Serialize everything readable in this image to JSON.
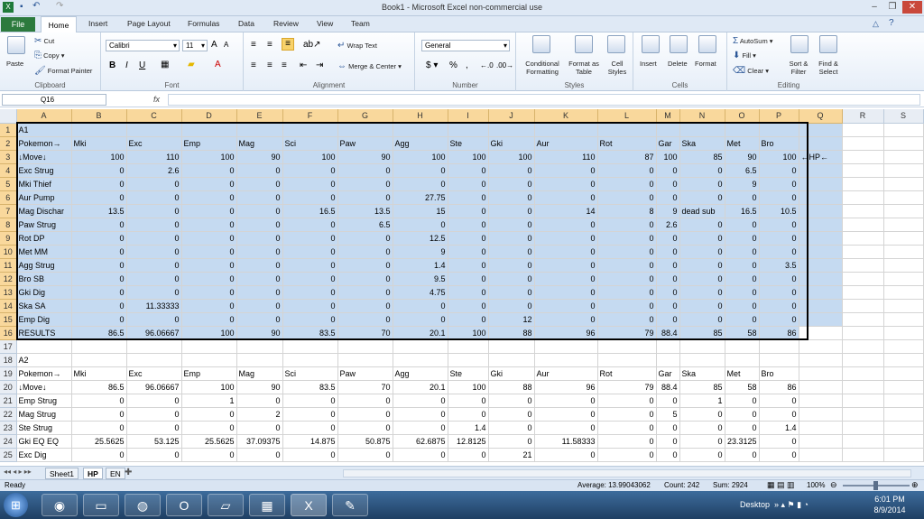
{
  "window": {
    "title": "Book1 - Microsoft Excel non-commercial use"
  },
  "tabs": [
    "File",
    "Home",
    "Insert",
    "Page Layout",
    "Formulas",
    "Data",
    "Review",
    "View",
    "Team"
  ],
  "ribbon": {
    "clipboard": {
      "paste": "Paste",
      "cut": "Cut",
      "copy": "Copy",
      "format_painter": "Format Painter",
      "label": "Clipboard"
    },
    "font": {
      "name": "Calibri",
      "size": "11",
      "label": "Font"
    },
    "alignment": {
      "wrap": "Wrap Text",
      "merge": "Merge & Center",
      "label": "Alignment"
    },
    "number": {
      "format": "General",
      "label": "Number"
    },
    "styles": {
      "cond": "Conditional Formatting",
      "fmt_table": "Format as Table",
      "cell_styles": "Cell Styles",
      "label": "Styles"
    },
    "cells": {
      "insert": "Insert",
      "delete": "Delete",
      "format": "Format",
      "label": "Cells"
    },
    "editing": {
      "autosum": "AutoSum",
      "fill": "Fill",
      "clear": "Clear",
      "sort": "Sort & Filter",
      "find": "Find & Select",
      "label": "Editing"
    }
  },
  "formula_bar": {
    "name_box": "Q16",
    "fx": "fx",
    "value": ""
  },
  "columns": [
    "A",
    "B",
    "C",
    "D",
    "E",
    "F",
    "G",
    "H",
    "I",
    "J",
    "K",
    "L",
    "M",
    "N",
    "O",
    "P",
    "Q",
    "R",
    "S"
  ],
  "rows": [
    {
      "n": "1",
      "c": [
        "A1",
        "",
        "",
        "",
        "",
        "",
        "",
        "",
        "",
        "",
        "",
        "",
        "",
        "",
        "",
        "",
        ""
      ]
    },
    {
      "n": "2",
      "c": [
        "Pokemon→",
        "Mki",
        "Exc",
        "Emp",
        "Mag",
        "Sci",
        "Paw",
        "Agg",
        "Ste",
        "Gki",
        "Aur",
        "Rot",
        "Gar",
        "Ska",
        "Met",
        "Bro",
        ""
      ]
    },
    {
      "n": "3",
      "c": [
        "↓Move↓",
        "100",
        "110",
        "100",
        "90",
        "100",
        "90",
        "100",
        "100",
        "100",
        "110",
        "87",
        "100",
        "85",
        "90",
        "100",
        "←HP←"
      ]
    },
    {
      "n": "4",
      "c": [
        "Exc Strug",
        "0",
        "2.6",
        "0",
        "0",
        "0",
        "0",
        "0",
        "0",
        "0",
        "0",
        "0",
        "0",
        "0",
        "6.5",
        "0",
        ""
      ]
    },
    {
      "n": "5",
      "c": [
        "Mki Thief",
        "0",
        "0",
        "0",
        "0",
        "0",
        "0",
        "0",
        "0",
        "0",
        "0",
        "0",
        "0",
        "0",
        "9",
        "0",
        ""
      ]
    },
    {
      "n": "6",
      "c": [
        "Aur Pump",
        "0",
        "0",
        "0",
        "0",
        "0",
        "0",
        "27.75",
        "0",
        "0",
        "0",
        "0",
        "0",
        "0",
        "0",
        "0",
        ""
      ]
    },
    {
      "n": "7",
      "c": [
        "Mag Dischar",
        "13.5",
        "0",
        "0",
        "0",
        "16.5",
        "13.5",
        "15",
        "0",
        "0",
        "14",
        "8",
        "9",
        "dead sub",
        "16.5",
        "10.5",
        ""
      ]
    },
    {
      "n": "8",
      "c": [
        "Paw Strug",
        "0",
        "0",
        "0",
        "0",
        "0",
        "6.5",
        "0",
        "0",
        "0",
        "0",
        "0",
        "2.6",
        "0",
        "0",
        "0",
        ""
      ]
    },
    {
      "n": "9",
      "c": [
        "Rot DP",
        "0",
        "0",
        "0",
        "0",
        "0",
        "0",
        "12.5",
        "0",
        "0",
        "0",
        "0",
        "0",
        "0",
        "0",
        "0",
        ""
      ]
    },
    {
      "n": "10",
      "c": [
        "Met MM",
        "0",
        "0",
        "0",
        "0",
        "0",
        "0",
        "9",
        "0",
        "0",
        "0",
        "0",
        "0",
        "0",
        "0",
        "0",
        ""
      ]
    },
    {
      "n": "11",
      "c": [
        "Agg Strug",
        "0",
        "0",
        "0",
        "0",
        "0",
        "0",
        "1.4",
        "0",
        "0",
        "0",
        "0",
        "0",
        "0",
        "0",
        "3.5",
        ""
      ]
    },
    {
      "n": "12",
      "c": [
        "Bro SB",
        "0",
        "0",
        "0",
        "0",
        "0",
        "0",
        "9.5",
        "0",
        "0",
        "0",
        "0",
        "0",
        "0",
        "0",
        "0",
        ""
      ]
    },
    {
      "n": "13",
      "c": [
        "Gki Dig",
        "0",
        "0",
        "0",
        "0",
        "0",
        "0",
        "4.75",
        "0",
        "0",
        "0",
        "0",
        "0",
        "0",
        "0",
        "0",
        ""
      ]
    },
    {
      "n": "14",
      "c": [
        "Ska SA",
        "0",
        "11.33333",
        "0",
        "0",
        "0",
        "0",
        "0",
        "0",
        "0",
        "0",
        "0",
        "0",
        "0",
        "0",
        "0",
        ""
      ]
    },
    {
      "n": "15",
      "c": [
        "Emp Dig",
        "0",
        "0",
        "0",
        "0",
        "0",
        "0",
        "0",
        "0",
        "12",
        "0",
        "0",
        "0",
        "0",
        "0",
        "0",
        ""
      ]
    },
    {
      "n": "16",
      "c": [
        "RESULTS",
        "86.5",
        "96.06667",
        "100",
        "90",
        "83.5",
        "70",
        "20.1",
        "100",
        "88",
        "96",
        "79",
        "88.4",
        "85",
        "58",
        "86",
        ""
      ]
    },
    {
      "n": "17",
      "c": [
        "",
        "",
        "",
        "",
        "",
        "",
        "",
        "",
        "",
        "",
        "",
        "",
        "",
        "",
        "",
        "",
        ""
      ]
    },
    {
      "n": "18",
      "c": [
        "A2",
        "",
        "",
        "",
        "",
        "",
        "",
        "",
        "",
        "",
        "",
        "",
        "",
        "",
        "",
        "",
        ""
      ]
    },
    {
      "n": "19",
      "c": [
        "Pokemon→",
        "Mki",
        "Exc",
        "Emp",
        "Mag",
        "Sci",
        "Paw",
        "Agg",
        "Ste",
        "Gki",
        "Aur",
        "Rot",
        "Gar",
        "Ska",
        "Met",
        "Bro",
        ""
      ]
    },
    {
      "n": "20",
      "c": [
        "↓Move↓",
        "86.5",
        "96.06667",
        "100",
        "90",
        "83.5",
        "70",
        "20.1",
        "100",
        "88",
        "96",
        "79",
        "88.4",
        "85",
        "58",
        "86",
        ""
      ]
    },
    {
      "n": "21",
      "c": [
        "Emp Strug",
        "0",
        "0",
        "1",
        "0",
        "0",
        "0",
        "0",
        "0",
        "0",
        "0",
        "0",
        "0",
        "1",
        "0",
        "0",
        ""
      ]
    },
    {
      "n": "22",
      "c": [
        "Mag Strug",
        "0",
        "0",
        "0",
        "2",
        "0",
        "0",
        "0",
        "0",
        "0",
        "0",
        "0",
        "5",
        "0",
        "0",
        "0",
        ""
      ]
    },
    {
      "n": "23",
      "c": [
        "Ste Strug",
        "0",
        "0",
        "0",
        "0",
        "0",
        "0",
        "0",
        "1.4",
        "0",
        "0",
        "0",
        "0",
        "0",
        "0",
        "1.4",
        ""
      ]
    },
    {
      "n": "24",
      "c": [
        "Gki EQ EQ",
        "25.5625",
        "53.125",
        "25.5625",
        "37.09375",
        "14.875",
        "50.875",
        "62.6875",
        "12.8125",
        "0",
        "11.58333",
        "0",
        "0",
        "0",
        "23.3125",
        "0",
        ""
      ]
    },
    {
      "n": "25",
      "c": [
        "Exc Dig",
        "0",
        "0",
        "0",
        "0",
        "0",
        "0",
        "0",
        "0",
        "21",
        "0",
        "0",
        "0",
        "0",
        "0",
        "0",
        ""
      ]
    }
  ],
  "sheets": [
    "Sheet1",
    "HP",
    "EN"
  ],
  "status": {
    "ready": "Ready",
    "average": "Average: 13.99043062",
    "count": "Count: 242",
    "sum": "Sum: 2924",
    "zoom": "100%"
  },
  "taskbar": {
    "desktop": "Desktop",
    "time": "6:01 PM",
    "date": "8/9/2014"
  }
}
